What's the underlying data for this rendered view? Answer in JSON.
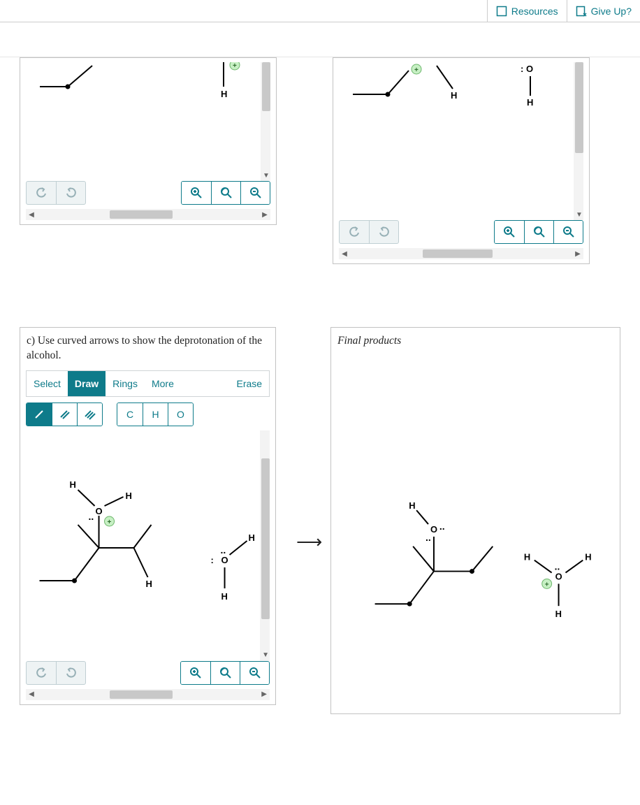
{
  "topbar": {
    "resources": "Resources",
    "give_up": "Give Up?"
  },
  "panels": {
    "c": {
      "prompt": "c) Use curved arrows to show the deprotonation of the alcohol.",
      "tabs": {
        "select": "Select",
        "draw": "Draw",
        "rings": "Rings",
        "more": "More",
        "erase": "Erase"
      },
      "bond_tools": {
        "single": "/",
        "double": "//",
        "triple": "///"
      },
      "atoms": {
        "C": "C",
        "H": "H",
        "O": "O"
      }
    },
    "final": {
      "title": "Final products"
    }
  },
  "chem_labels": {
    "H": "H",
    "O": "O",
    "lone_pair": ":",
    "double_dot": "..",
    "plus": "+",
    "colon_O": ": O"
  }
}
